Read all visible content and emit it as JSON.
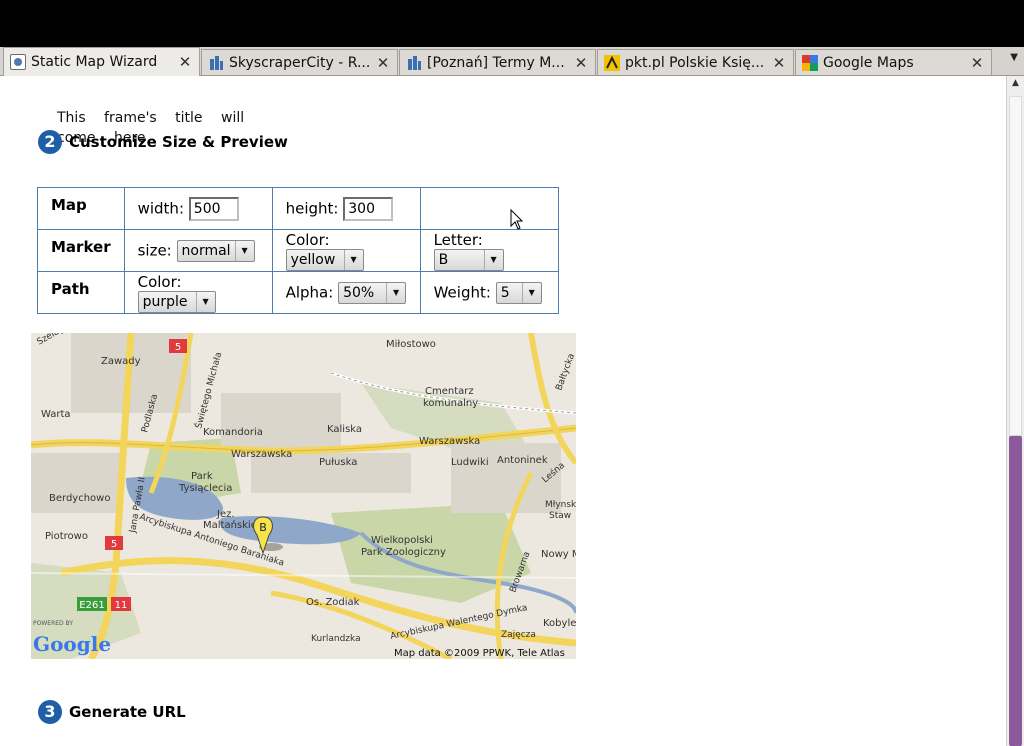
{
  "browser": {
    "tabs": [
      {
        "label": "Static Map Wizard",
        "active": true,
        "icon": "page-icon"
      },
      {
        "label": "SkyscraperCity - R...",
        "active": false,
        "icon": "city-icon"
      },
      {
        "label": "[Poznań] Termy M...",
        "active": false,
        "icon": "city-icon"
      },
      {
        "label": "pkt.pl Polskie Księ...",
        "active": false,
        "icon": "pkt-icon"
      },
      {
        "label": "Google Maps",
        "active": false,
        "icon": "google-icon"
      }
    ],
    "close_glyph": "✕",
    "menu_glyph": "▼"
  },
  "page": {
    "frame_title": "This frame's title will come here",
    "step2": {
      "num": "2",
      "title": "Customize Size & Preview"
    },
    "step3": {
      "num": "3",
      "title": "Generate URL"
    },
    "table": {
      "map": {
        "head": "Map",
        "width_label": "width:",
        "width_value": "500",
        "height_label": "height:",
        "height_value": "300"
      },
      "marker": {
        "head": "Marker",
        "size_label": "size:",
        "size_value": "normal",
        "color_label": "Color:",
        "color_value": "yellow",
        "letter_label": "Letter:",
        "letter_value": "B"
      },
      "path": {
        "head": "Path",
        "color_label": "Color:",
        "color_value": "purple",
        "alpha_label": "Alpha:",
        "alpha_value": "50%",
        "weight_label": "Weight:",
        "weight_value": "5"
      }
    },
    "map": {
      "labels": {
        "milostowo": "Miłostowo",
        "zawady": "Zawady",
        "warta": "Warta",
        "komandoria": "Komandoria",
        "kaliska": "Kaliska",
        "warszawska1": "Warszawska",
        "warszawska2": "Warszawska",
        "cmentarz": "Cmentarz",
        "komunalny": "komunalny",
        "pulaska": "Pułuska",
        "ludwiki": "Ludwiki",
        "antoninek": "Antoninek",
        "park": "Park",
        "tysiaclecia": "Tysiąclecia",
        "berdychowo": "Berdychowo",
        "jez": "Jez.",
        "maltanskie": "Maltańskie",
        "piotrowo": "Piotrowo",
        "arcybiskupa": "Arcybiskupa Antoniego Baraniaka",
        "wielkopolski": "Wielkopolski",
        "parkzoo": "Park Zoologiczny",
        "osz": "Os. Zodiak",
        "kurlandzka": "Kurlandzka",
        "dymka": "Arcybiskupa Walentego Dymka",
        "kobyle": "Kobyle",
        "zajecza": "Zajęcza",
        "nowym": "Nowy M",
        "mlynski": "Młynski",
        "staw": "Staw",
        "browarna": "Browarna",
        "baltycka": "Bałtycka",
        "lesna": "Leśna",
        "swietego": "Świętego Michała",
        "jana_pawla": "Jana Pawła II",
        "szelagowska": "Szelag",
        "podlaska": "Podlaska",
        "r5a": "5",
        "r5b": "5",
        "e261": "E261",
        "r11": "11",
        "copyright": "Map data ©2009 PPWK, Tele Atlas",
        "powered": "POWERED BY",
        "google": "Google",
        "marker_letter": "B"
      }
    }
  },
  "colors": {
    "accent": "#1f5fa7",
    "table_border": "#4d7fb0",
    "road": "#f3d55c",
    "water": "#8fa7c9",
    "park": "#c9d7a8"
  }
}
